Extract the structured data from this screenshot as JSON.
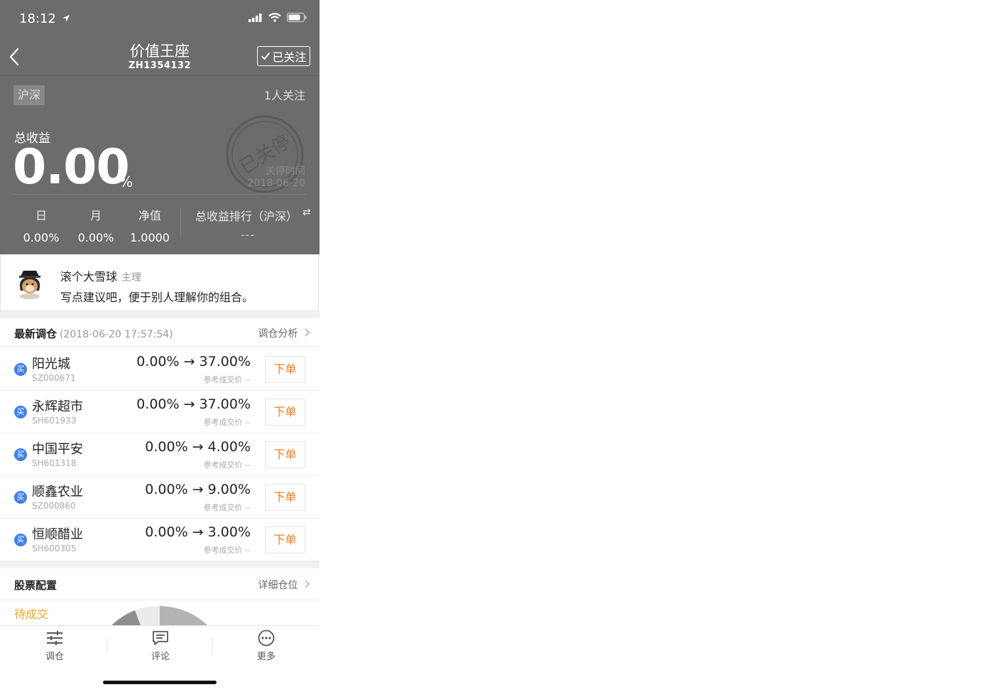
{
  "status_bar": {
    "time": "18:12"
  },
  "nav": {
    "title": "价值王座",
    "subtitle": "ZH1354132",
    "follow_label": "已关注"
  },
  "header": {
    "market_tag": "沪深",
    "followers": "1人关注",
    "total_label": "总收益",
    "total_value": "0.00",
    "total_unit": "%",
    "stamp_text": "已关停",
    "stamp_time_label": "关停时间",
    "stamp_date": "2018-06-20"
  },
  "stats": [
    {
      "label": "日",
      "value": "0.00%"
    },
    {
      "label": "月",
      "value": "0.00%"
    },
    {
      "label": "净值",
      "value": "1.0000"
    }
  ],
  "rank": {
    "label": "总收益排行（沪深）",
    "value": "---",
    "swap_icon": "swap-icon"
  },
  "manager": {
    "name": "滚个大雪球",
    "role": "主理",
    "description": "写点建议吧，便于别人理解你的组合。"
  },
  "rebalance": {
    "title": "最新调仓",
    "date": "(2018-06-20 17:57:54)",
    "link": "调仓分析",
    "rows": [
      {
        "badge": "买",
        "name": "阳光城",
        "code": "SZ000671",
        "change": "0.00% → 37.00%",
        "ref": "参考成交价 --",
        "button": "下单"
      },
      {
        "badge": "买",
        "name": "永辉超市",
        "code": "SH601933",
        "change": "0.00% → 37.00%",
        "ref": "参考成交价 --",
        "button": "下单"
      },
      {
        "badge": "买",
        "name": "中国平安",
        "code": "SH601318",
        "change": "0.00% → 4.00%",
        "ref": "参考成交价 --",
        "button": "下单"
      },
      {
        "badge": "买",
        "name": "顺鑫农业",
        "code": "SZ000860",
        "change": "0.00% → 9.00%",
        "ref": "参考成交价 --",
        "button": "下单"
      },
      {
        "badge": "买",
        "name": "恒顺醋业",
        "code": "SH600305",
        "change": "0.00% → 3.00%",
        "ref": "参考成交价 --",
        "button": "下单"
      }
    ]
  },
  "allocation": {
    "title": "股票配置",
    "link": "详细仓位",
    "pending": "待成交"
  },
  "tabbar": [
    {
      "label": "调仓",
      "icon": "sliders-icon"
    },
    {
      "label": "评论",
      "icon": "comment-icon"
    },
    {
      "label": "更多",
      "icon": "more-icon"
    }
  ],
  "colors": {
    "header_bg": "#6c6c6c",
    "accent_orange": "#f57c1f",
    "buy_blue": "#3d7ff3",
    "pending_yellow": "#f5a623"
  }
}
